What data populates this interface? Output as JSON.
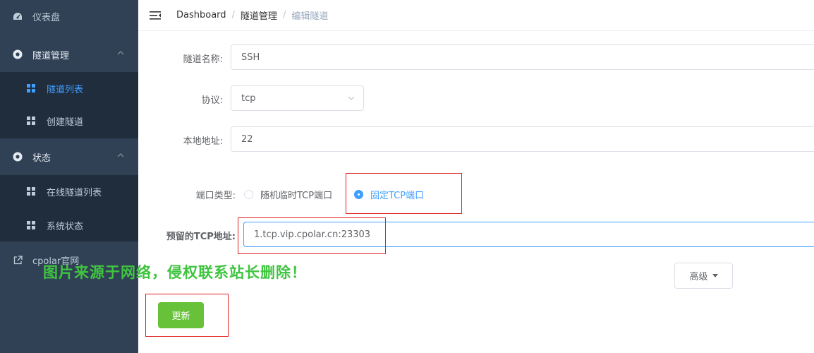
{
  "sidebar": {
    "dashboard": "仪表盘",
    "tunnel_group": "隧道管理",
    "tunnel_list": "隧道列表",
    "create_tunnel": "创建隧道",
    "status_group": "状态",
    "online_tunnels": "在线隧道列表",
    "system_status": "系统状态",
    "cpolar_site": "cpolar官网"
  },
  "breadcrumb": {
    "home": "Dashboard",
    "section": "隧道管理",
    "current": "编辑隧道",
    "separator": "/"
  },
  "form": {
    "name_label": "隧道名称:",
    "name_value": "SSH",
    "protocol_label": "协议:",
    "protocol_value": "tcp",
    "local_label": "本地地址:",
    "local_value": "22",
    "port_type_label": "端口类型:",
    "port_random": "随机临时TCP端口",
    "port_fixed": "固定TCP端口",
    "reserved_label": "预留的TCP地址:",
    "reserved_value": "1.tcp.vip.cpolar.cn:23303",
    "advanced_button": "高级",
    "update_button": "更新"
  },
  "watermark": "图片来源于网络，侵权联系站长删除！",
  "colors": {
    "sidebar_bg": "#304156",
    "submenu_bg": "#1f2d3d",
    "accent": "#409eff",
    "success": "#67c23a",
    "highlight_box": "#e02020"
  }
}
